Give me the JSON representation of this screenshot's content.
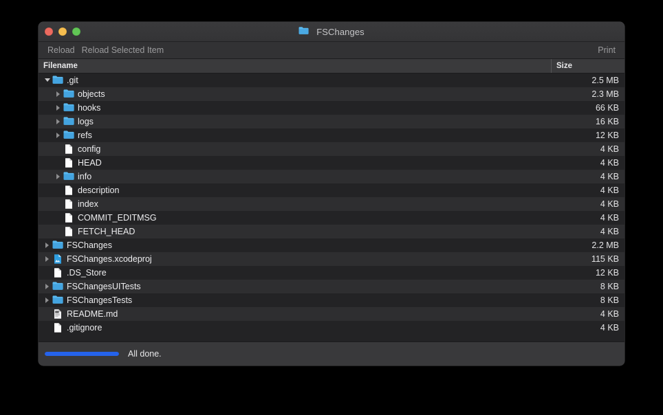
{
  "window": {
    "title": "FSChanges",
    "title_icon": "folder-icon",
    "traffic_lights": [
      {
        "name": "close-button",
        "color": "#ec6a5f"
      },
      {
        "name": "minimize-button",
        "color": "#f5bd4f"
      },
      {
        "name": "maximize-button",
        "color": "#61c555"
      }
    ]
  },
  "toolbar": {
    "reload_label": "Reload",
    "reload_selected_label": "Reload Selected Item",
    "print_label": "Print"
  },
  "columns": {
    "filename": "Filename",
    "size": "Size"
  },
  "rows": [
    {
      "name": ".git",
      "size": "2.5 MB",
      "depth": 0,
      "icon": "folder-icon",
      "twisty": "down"
    },
    {
      "name": "objects",
      "size": "2.3 MB",
      "depth": 1,
      "icon": "folder-icon",
      "twisty": "right"
    },
    {
      "name": "hooks",
      "size": "66 KB",
      "depth": 1,
      "icon": "folder-icon",
      "twisty": "right"
    },
    {
      "name": "logs",
      "size": "16 KB",
      "depth": 1,
      "icon": "folder-icon",
      "twisty": "right"
    },
    {
      "name": "refs",
      "size": "12 KB",
      "depth": 1,
      "icon": "folder-icon",
      "twisty": "right"
    },
    {
      "name": "config",
      "size": "4 KB",
      "depth": 1,
      "icon": "document-icon",
      "twisty": "none"
    },
    {
      "name": "HEAD",
      "size": "4 KB",
      "depth": 1,
      "icon": "document-icon",
      "twisty": "none"
    },
    {
      "name": "info",
      "size": "4 KB",
      "depth": 1,
      "icon": "folder-icon",
      "twisty": "right"
    },
    {
      "name": "description",
      "size": "4 KB",
      "depth": 1,
      "icon": "document-icon",
      "twisty": "none"
    },
    {
      "name": "index",
      "size": "4 KB",
      "depth": 1,
      "icon": "document-icon",
      "twisty": "none"
    },
    {
      "name": "COMMIT_EDITMSG",
      "size": "4 KB",
      "depth": 1,
      "icon": "document-icon",
      "twisty": "none"
    },
    {
      "name": "FETCH_HEAD",
      "size": "4 KB",
      "depth": 1,
      "icon": "document-icon",
      "twisty": "none"
    },
    {
      "name": "FSChanges",
      "size": "2.2 MB",
      "depth": 0,
      "icon": "folder-icon",
      "twisty": "right"
    },
    {
      "name": "FSChanges.xcodeproj",
      "size": "115 KB",
      "depth": 0,
      "icon": "xcodeproj-icon",
      "twisty": "right"
    },
    {
      "name": ".DS_Store",
      "size": "12 KB",
      "depth": 0,
      "icon": "document-icon",
      "twisty": "none"
    },
    {
      "name": "FSChangesUITests",
      "size": "8 KB",
      "depth": 0,
      "icon": "folder-icon",
      "twisty": "right"
    },
    {
      "name": "FSChangesTests",
      "size": "8 KB",
      "depth": 0,
      "icon": "folder-icon",
      "twisty": "right"
    },
    {
      "name": "README.md",
      "size": "4 KB",
      "depth": 0,
      "icon": "markdown-icon",
      "twisty": "none"
    },
    {
      "name": ".gitignore",
      "size": "4 KB",
      "depth": 0,
      "icon": "document-icon",
      "twisty": "none"
    }
  ],
  "status": {
    "message": "All done.",
    "progress_percent": 100,
    "progress_color": "#2563eb"
  }
}
